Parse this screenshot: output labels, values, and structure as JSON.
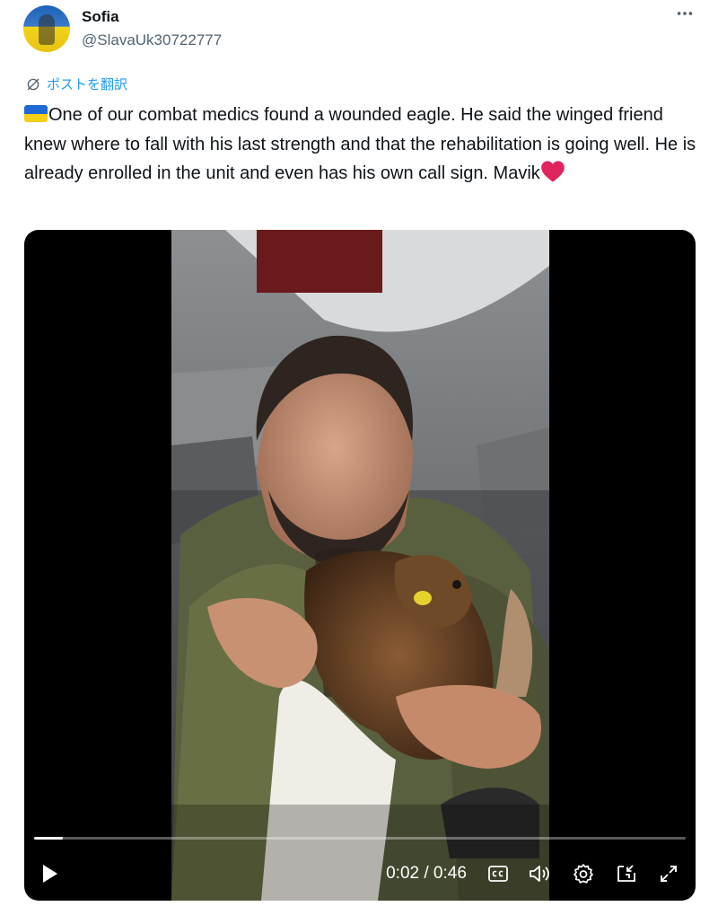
{
  "author": {
    "name": "Sofia",
    "handle": "@SlavaUk30722777"
  },
  "translate_label": "ポストを翻訳",
  "post_text": "One of our combat medics found a wounded eagle. He said the winged friend knew where to fall with his last strength and that the rehabilitation is going well. He is already enrolled in the unit and even has his own call sign. Mavik",
  "emoji": {
    "leading": "ukraine-flag",
    "trailing": "red-heart"
  },
  "video": {
    "time_display": "0:02 / 0:46",
    "progress_fraction": 0.0435,
    "controls": [
      "play-icon",
      "captions-icon",
      "volume-icon",
      "settings-icon",
      "pip-icon",
      "fullscreen-icon"
    ]
  },
  "colors": {
    "link": "#1d9bf0",
    "handle": "#536471",
    "text": "#0f1419"
  }
}
